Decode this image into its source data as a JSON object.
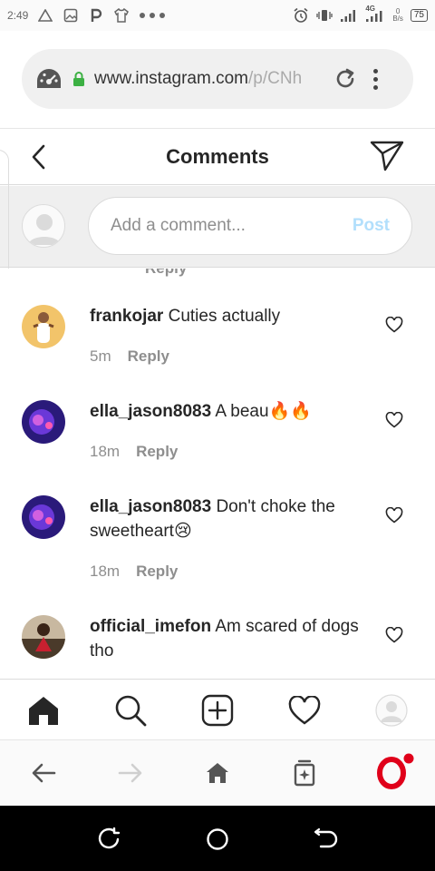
{
  "status_bar": {
    "time": "2:49",
    "network": "4G",
    "speed_value": "0",
    "speed_unit": "B/s",
    "battery": "75"
  },
  "browser": {
    "url_main": "www.instagram.com",
    "url_path": "/p/CNh"
  },
  "header": {
    "title": "Comments"
  },
  "composer": {
    "placeholder": "Add a comment...",
    "post_label": "Post"
  },
  "partial_reply": "Reply",
  "comments": [
    {
      "username": "frankojar",
      "text": "Cuties actually",
      "time": "5m",
      "reply_label": "Reply"
    },
    {
      "username": "ella_jason8083",
      "text": "A beau🔥🔥",
      "time": "18m",
      "reply_label": "Reply"
    },
    {
      "username": "ella_jason8083",
      "text": "Don't choke the sweetheart😢",
      "time": "18m",
      "reply_label": "Reply"
    },
    {
      "username": "official_imefon",
      "text": "Am scared of dogs tho",
      "time": "",
      "reply_label": ""
    }
  ],
  "colors": {
    "post_disabled": "#b2dffc",
    "opera_red": "#e0001a",
    "notification_dot": "#e0001a"
  }
}
